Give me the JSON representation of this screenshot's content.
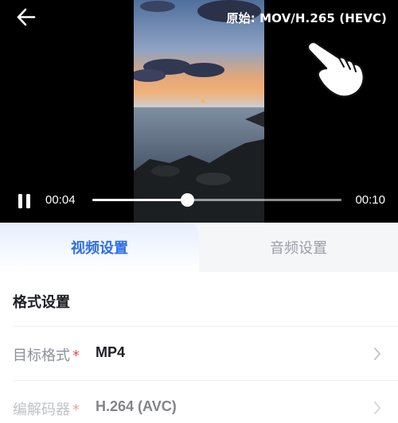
{
  "player": {
    "source_format": "原始: MOV/H.265 (HEVC)",
    "current_time": "00:04",
    "total_time": "00:10",
    "progress": 0.38,
    "state": "playing"
  },
  "tabs": [
    {
      "label": "视频设置",
      "active": true
    },
    {
      "label": "音频设置",
      "active": false
    }
  ],
  "format_settings": {
    "title": "格式设置",
    "rows": [
      {
        "label": "目标格式",
        "required_mark": "*",
        "value": "MP4"
      },
      {
        "label": "编解码器",
        "required_mark": "*",
        "value": "H.264 (AVC)"
      }
    ]
  },
  "colors": {
    "accent": "#2f6fe6",
    "required": "#e5484d",
    "muted_text": "#8e9199"
  },
  "icons": [
    "back-arrow-icon",
    "tap-hand-icon",
    "pause-icon",
    "chevron-right-icon"
  ]
}
